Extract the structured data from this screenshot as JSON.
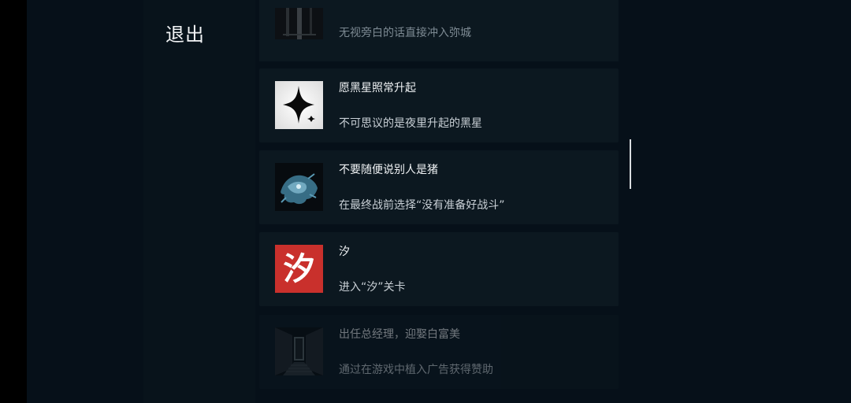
{
  "header": {
    "exit_label": "退出"
  },
  "achievements": [
    {
      "title": "",
      "description": "无视旁白的话直接冲入弥城",
      "icon": "tower-image",
      "faded": false
    },
    {
      "title": "愿黑星照常升起",
      "description": "不可思议的是夜里升起的黑星",
      "icon": "black-star-icon",
      "faded": false
    },
    {
      "title": "不要随便说别人是猪",
      "description": "在最终战前选择“没有准备好战斗”",
      "icon": "blue-creature-icon",
      "faded": false
    },
    {
      "title": "汐",
      "description": "进入“汐”关卡",
      "icon": "red-xi-icon",
      "icon_text": "汐",
      "faded": false
    },
    {
      "title": "出任总经理，迎娶白富美",
      "description": "通过在游戏中植入广告获得赞助",
      "icon": "door-corridor-icon",
      "faded": true
    }
  ],
  "colors": {
    "background": "#061019",
    "card": "#0c1820",
    "red_icon": "#c9302c"
  }
}
